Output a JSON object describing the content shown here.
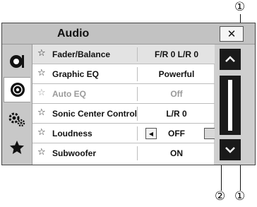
{
  "header": {
    "title": "Audio",
    "close_label": "✕"
  },
  "sidebar": {
    "tabs": [
      {
        "icon": "audio-source-icon",
        "active": false
      },
      {
        "icon": "disc-icon",
        "active": true
      },
      {
        "icon": "settings-gear-icon",
        "active": false
      },
      {
        "icon": "favorites-star-icon",
        "active": false
      }
    ]
  },
  "settings": [
    {
      "label": "Fader/Balance",
      "value": "F/R 0  L/R 0",
      "enabled": true,
      "selected": true
    },
    {
      "label": "Graphic EQ",
      "value": "Powerful",
      "enabled": true,
      "selected": false
    },
    {
      "label": "Auto EQ",
      "value": "Off",
      "enabled": false,
      "selected": false
    },
    {
      "label": "Sonic Center Control",
      "value": "L/R 0",
      "enabled": true,
      "selected": false
    },
    {
      "label": "Loudness",
      "value": "OFF",
      "enabled": true,
      "selected": false
    },
    {
      "label": "Subwoofer",
      "value": "ON",
      "enabled": true,
      "selected": false
    }
  ],
  "favorite_icon": "☆",
  "callouts": {
    "scroll_buttons": "①",
    "scrollbar": "②"
  }
}
